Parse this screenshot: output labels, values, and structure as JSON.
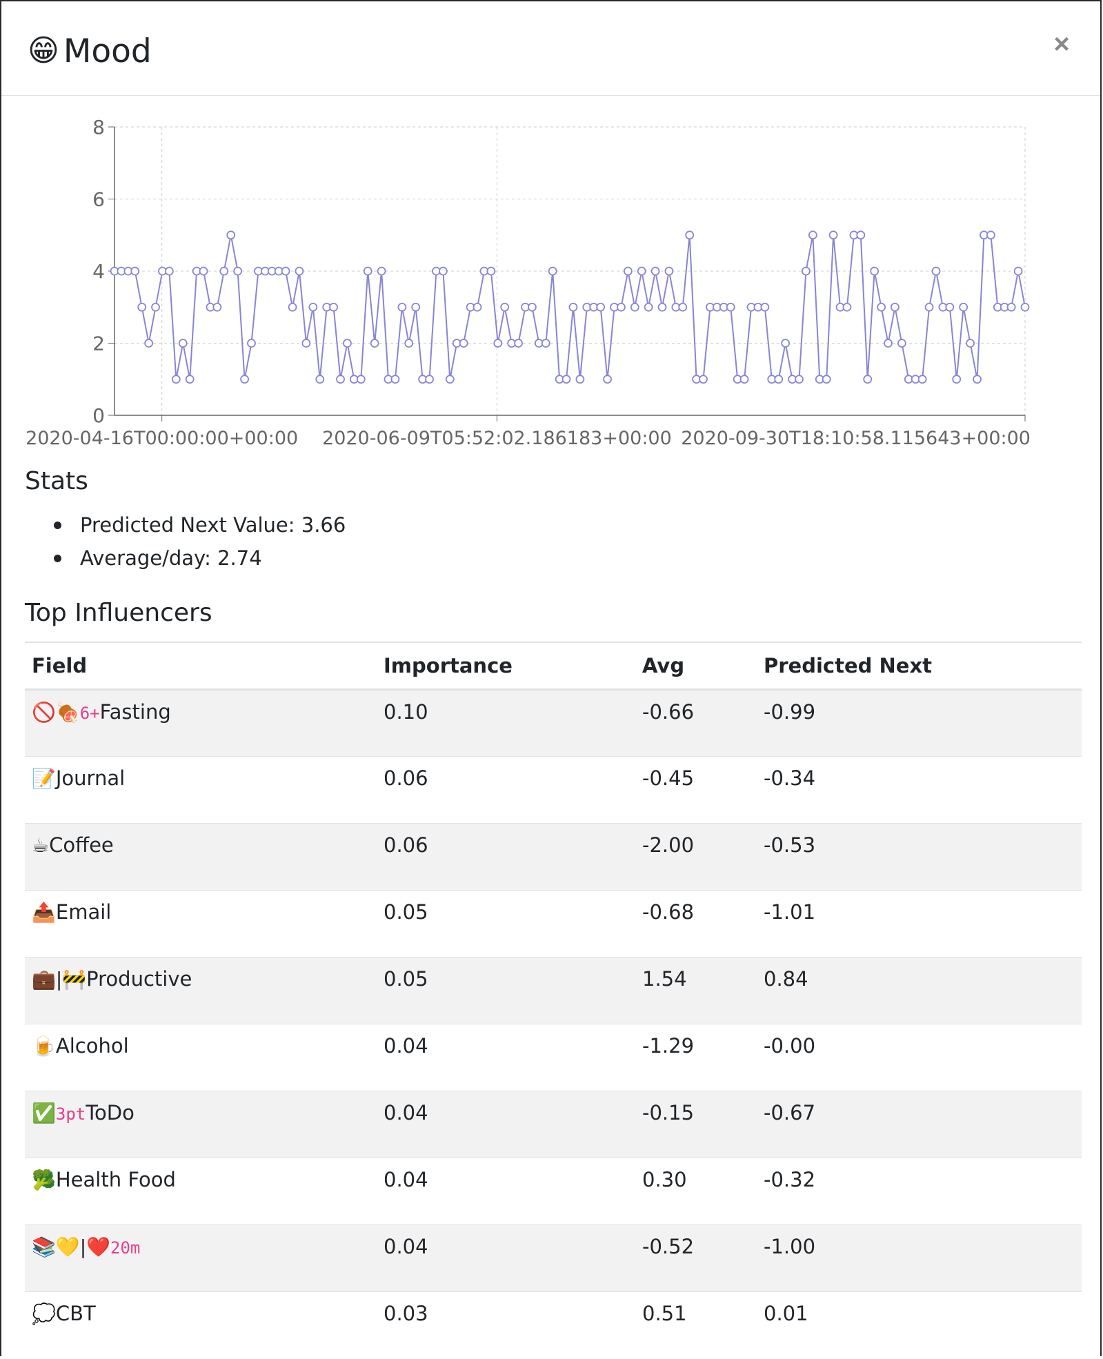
{
  "header": {
    "icon": "😁",
    "title": "Mood",
    "close_label": "×"
  },
  "chart_data": {
    "type": "line",
    "xlabel": "",
    "ylabel": "",
    "ylim": [
      0,
      8
    ],
    "yticks": [
      "0",
      "2",
      "4",
      "6",
      "8"
    ],
    "xtick_labels": [
      "2020-04-16T00:00:00+00:00",
      "2020-06-09T05:52:02.186183+00:00",
      "2020-09-30T18:10:58.115643+00:00"
    ],
    "grid": true,
    "line_color": "#8884d8",
    "series": [
      {
        "values": [
          4,
          4,
          4,
          4,
          3,
          2,
          3,
          4,
          4,
          1,
          2,
          1,
          4,
          4,
          3,
          3,
          4,
          5,
          4,
          1,
          2,
          4,
          4,
          4,
          4,
          4,
          3,
          4,
          2,
          3,
          1,
          3,
          3,
          1,
          2,
          1,
          1,
          4,
          2,
          4,
          1,
          1,
          3,
          2,
          3,
          1,
          1,
          4,
          4,
          1,
          2,
          2,
          3,
          3,
          4,
          4,
          2,
          3,
          2,
          2,
          3,
          3,
          2,
          2,
          4,
          1,
          1,
          3,
          1,
          3,
          3,
          3,
          1,
          3,
          3,
          4,
          3,
          4,
          3,
          4,
          3,
          4,
          3,
          3,
          5,
          1,
          1,
          3,
          3,
          3,
          3,
          1,
          1,
          3,
          3,
          3,
          1,
          1,
          2,
          1,
          1,
          4,
          5,
          1,
          1,
          5,
          3,
          3,
          5,
          5,
          1,
          4,
          3,
          2,
          3,
          2,
          1,
          1,
          1,
          3,
          4,
          3,
          3,
          1,
          3,
          2,
          1,
          5,
          5,
          3,
          3,
          3,
          4,
          3
        ]
      }
    ]
  },
  "stats": {
    "heading": "Stats",
    "items": [
      "Predicted Next Value: 3.66",
      "Average/day: 2.74"
    ]
  },
  "influencers": {
    "heading": "Top Influencers",
    "columns": [
      "Field",
      "Importance",
      "Avg",
      "Predicted Next"
    ],
    "rows": [
      {
        "icons": "🚫🍖",
        "code": "6+",
        "name": "Fasting",
        "importance": "0.10",
        "avg": "-0.66",
        "next": "-0.99"
      },
      {
        "icons": "📝",
        "code": "",
        "name": "Journal",
        "importance": "0.06",
        "avg": "-0.45",
        "next": "-0.34"
      },
      {
        "icons": "☕",
        "code": "",
        "name": "Coffee",
        "importance": "0.06",
        "avg": "-2.00",
        "next": "-0.53"
      },
      {
        "icons": "📤",
        "code": "",
        "name": "Email",
        "importance": "0.05",
        "avg": "-0.68",
        "next": "-1.01"
      },
      {
        "icons": "💼|🚧",
        "code": "",
        "name": "Productive",
        "importance": "0.05",
        "avg": "1.54",
        "next": "0.84"
      },
      {
        "icons": "🍺",
        "code": "",
        "name": "Alcohol",
        "importance": "0.04",
        "avg": "-1.29",
        "next": "-0.00"
      },
      {
        "icons": "✅",
        "code": "3pt",
        "name": "ToDo",
        "importance": "0.04",
        "avg": "-0.15",
        "next": "-0.67"
      },
      {
        "icons": "🥦",
        "code": "",
        "name": "Health Food",
        "importance": "0.04",
        "avg": "0.30",
        "next": "-0.32"
      },
      {
        "icons": "📚💛|❤️",
        "code": "20m",
        "name": "",
        "importance": "0.04",
        "avg": "-0.52",
        "next": "-1.00"
      },
      {
        "icons": "💭",
        "code": "",
        "name": "CBT",
        "importance": "0.03",
        "avg": "0.51",
        "next": "0.01"
      }
    ]
  }
}
